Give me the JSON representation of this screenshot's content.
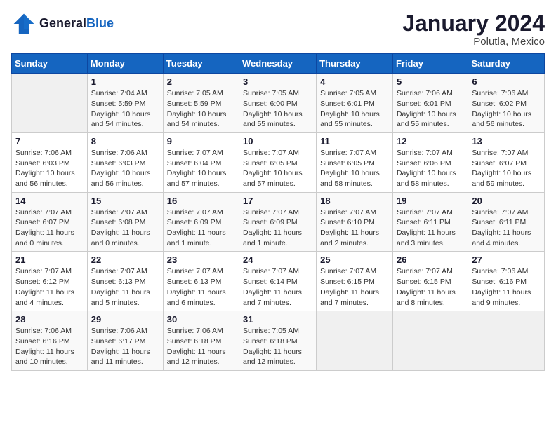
{
  "header": {
    "logo_line1": "General",
    "logo_line2": "Blue",
    "month": "January 2024",
    "location": "Polutla, Mexico"
  },
  "days_of_week": [
    "Sunday",
    "Monday",
    "Tuesday",
    "Wednesday",
    "Thursday",
    "Friday",
    "Saturday"
  ],
  "weeks": [
    [
      {
        "day": "",
        "sunrise": "",
        "sunset": "",
        "daylight": ""
      },
      {
        "day": "1",
        "sunrise": "Sunrise: 7:04 AM",
        "sunset": "Sunset: 5:59 PM",
        "daylight": "Daylight: 10 hours and 54 minutes."
      },
      {
        "day": "2",
        "sunrise": "Sunrise: 7:05 AM",
        "sunset": "Sunset: 5:59 PM",
        "daylight": "Daylight: 10 hours and 54 minutes."
      },
      {
        "day": "3",
        "sunrise": "Sunrise: 7:05 AM",
        "sunset": "Sunset: 6:00 PM",
        "daylight": "Daylight: 10 hours and 55 minutes."
      },
      {
        "day": "4",
        "sunrise": "Sunrise: 7:05 AM",
        "sunset": "Sunset: 6:01 PM",
        "daylight": "Daylight: 10 hours and 55 minutes."
      },
      {
        "day": "5",
        "sunrise": "Sunrise: 7:06 AM",
        "sunset": "Sunset: 6:01 PM",
        "daylight": "Daylight: 10 hours and 55 minutes."
      },
      {
        "day": "6",
        "sunrise": "Sunrise: 7:06 AM",
        "sunset": "Sunset: 6:02 PM",
        "daylight": "Daylight: 10 hours and 56 minutes."
      }
    ],
    [
      {
        "day": "7",
        "sunrise": "Sunrise: 7:06 AM",
        "sunset": "Sunset: 6:03 PM",
        "daylight": "Daylight: 10 hours and 56 minutes."
      },
      {
        "day": "8",
        "sunrise": "Sunrise: 7:06 AM",
        "sunset": "Sunset: 6:03 PM",
        "daylight": "Daylight: 10 hours and 56 minutes."
      },
      {
        "day": "9",
        "sunrise": "Sunrise: 7:07 AM",
        "sunset": "Sunset: 6:04 PM",
        "daylight": "Daylight: 10 hours and 57 minutes."
      },
      {
        "day": "10",
        "sunrise": "Sunrise: 7:07 AM",
        "sunset": "Sunset: 6:05 PM",
        "daylight": "Daylight: 10 hours and 57 minutes."
      },
      {
        "day": "11",
        "sunrise": "Sunrise: 7:07 AM",
        "sunset": "Sunset: 6:05 PM",
        "daylight": "Daylight: 10 hours and 58 minutes."
      },
      {
        "day": "12",
        "sunrise": "Sunrise: 7:07 AM",
        "sunset": "Sunset: 6:06 PM",
        "daylight": "Daylight: 10 hours and 58 minutes."
      },
      {
        "day": "13",
        "sunrise": "Sunrise: 7:07 AM",
        "sunset": "Sunset: 6:07 PM",
        "daylight": "Daylight: 10 hours and 59 minutes."
      }
    ],
    [
      {
        "day": "14",
        "sunrise": "Sunrise: 7:07 AM",
        "sunset": "Sunset: 6:07 PM",
        "daylight": "Daylight: 11 hours and 0 minutes."
      },
      {
        "day": "15",
        "sunrise": "Sunrise: 7:07 AM",
        "sunset": "Sunset: 6:08 PM",
        "daylight": "Daylight: 11 hours and 0 minutes."
      },
      {
        "day": "16",
        "sunrise": "Sunrise: 7:07 AM",
        "sunset": "Sunset: 6:09 PM",
        "daylight": "Daylight: 11 hours and 1 minute."
      },
      {
        "day": "17",
        "sunrise": "Sunrise: 7:07 AM",
        "sunset": "Sunset: 6:09 PM",
        "daylight": "Daylight: 11 hours and 1 minute."
      },
      {
        "day": "18",
        "sunrise": "Sunrise: 7:07 AM",
        "sunset": "Sunset: 6:10 PM",
        "daylight": "Daylight: 11 hours and 2 minutes."
      },
      {
        "day": "19",
        "sunrise": "Sunrise: 7:07 AM",
        "sunset": "Sunset: 6:11 PM",
        "daylight": "Daylight: 11 hours and 3 minutes."
      },
      {
        "day": "20",
        "sunrise": "Sunrise: 7:07 AM",
        "sunset": "Sunset: 6:11 PM",
        "daylight": "Daylight: 11 hours and 4 minutes."
      }
    ],
    [
      {
        "day": "21",
        "sunrise": "Sunrise: 7:07 AM",
        "sunset": "Sunset: 6:12 PM",
        "daylight": "Daylight: 11 hours and 4 minutes."
      },
      {
        "day": "22",
        "sunrise": "Sunrise: 7:07 AM",
        "sunset": "Sunset: 6:13 PM",
        "daylight": "Daylight: 11 hours and 5 minutes."
      },
      {
        "day": "23",
        "sunrise": "Sunrise: 7:07 AM",
        "sunset": "Sunset: 6:13 PM",
        "daylight": "Daylight: 11 hours and 6 minutes."
      },
      {
        "day": "24",
        "sunrise": "Sunrise: 7:07 AM",
        "sunset": "Sunset: 6:14 PM",
        "daylight": "Daylight: 11 hours and 7 minutes."
      },
      {
        "day": "25",
        "sunrise": "Sunrise: 7:07 AM",
        "sunset": "Sunset: 6:15 PM",
        "daylight": "Daylight: 11 hours and 7 minutes."
      },
      {
        "day": "26",
        "sunrise": "Sunrise: 7:07 AM",
        "sunset": "Sunset: 6:15 PM",
        "daylight": "Daylight: 11 hours and 8 minutes."
      },
      {
        "day": "27",
        "sunrise": "Sunrise: 7:06 AM",
        "sunset": "Sunset: 6:16 PM",
        "daylight": "Daylight: 11 hours and 9 minutes."
      }
    ],
    [
      {
        "day": "28",
        "sunrise": "Sunrise: 7:06 AM",
        "sunset": "Sunset: 6:16 PM",
        "daylight": "Daylight: 11 hours and 10 minutes."
      },
      {
        "day": "29",
        "sunrise": "Sunrise: 7:06 AM",
        "sunset": "Sunset: 6:17 PM",
        "daylight": "Daylight: 11 hours and 11 minutes."
      },
      {
        "day": "30",
        "sunrise": "Sunrise: 7:06 AM",
        "sunset": "Sunset: 6:18 PM",
        "daylight": "Daylight: 11 hours and 12 minutes."
      },
      {
        "day": "31",
        "sunrise": "Sunrise: 7:05 AM",
        "sunset": "Sunset: 6:18 PM",
        "daylight": "Daylight: 11 hours and 12 minutes."
      },
      {
        "day": "",
        "sunrise": "",
        "sunset": "",
        "daylight": ""
      },
      {
        "day": "",
        "sunrise": "",
        "sunset": "",
        "daylight": ""
      },
      {
        "day": "",
        "sunrise": "",
        "sunset": "",
        "daylight": ""
      }
    ]
  ]
}
